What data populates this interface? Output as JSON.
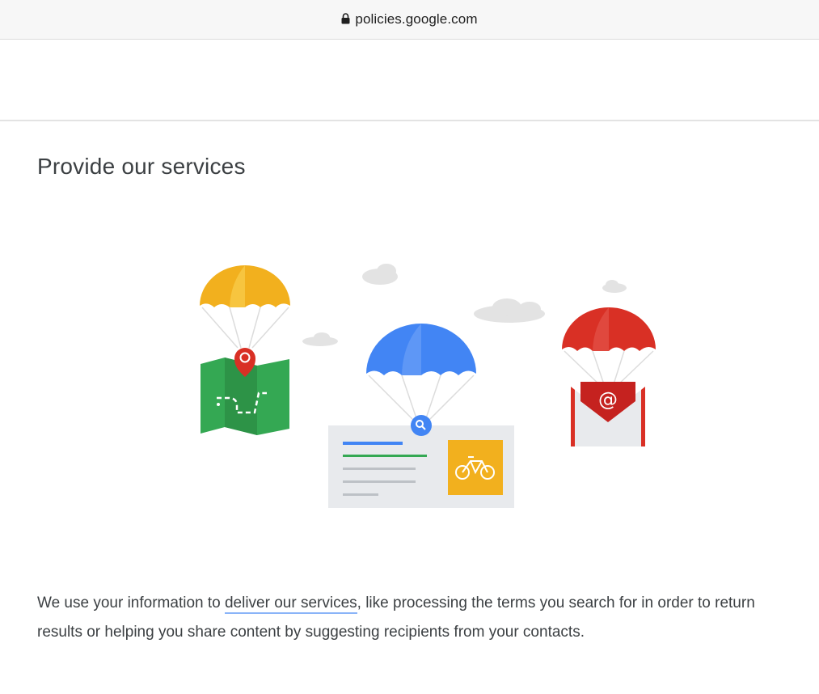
{
  "browser": {
    "url": "policies.google.com",
    "lock_icon": "lock-icon"
  },
  "section": {
    "title": "Provide our services"
  },
  "illustration": {
    "icons": [
      "map-pin-icon",
      "search-icon",
      "bicycle-icon",
      "at-sign-icon",
      "parachute-icon",
      "cloud-icon"
    ],
    "colors": {
      "yellow": "#f2b01e",
      "green": "#34a853",
      "blue": "#4285f4",
      "red": "#d93025",
      "cloud": "#e3e3e3"
    }
  },
  "body": {
    "text_before": "We use your information to ",
    "link_text": "deliver our services",
    "text_after": ", like processing the terms you search for in order to return results or helping you share content by suggesting recipients from your contacts."
  }
}
